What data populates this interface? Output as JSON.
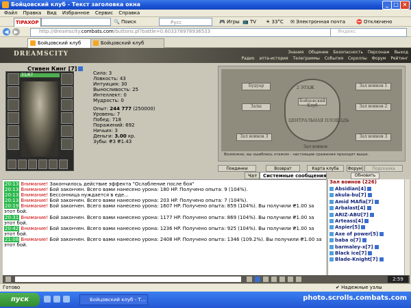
{
  "window": {
    "title": "Бойцовский клуб - Текст заголовка окна"
  },
  "menu": [
    "Файл",
    "Правка",
    "Вид",
    "Избранное",
    "Сервис",
    "Справка"
  ],
  "toolbar": {
    "brand": "TIPAXOP",
    "search_label": "Поиск",
    "search2_placeholder": "Русс",
    "games_label": "Игры",
    "tv_label": "TV",
    "weather": "33°C",
    "email": "Электронная почта",
    "disabled": "Отключено"
  },
  "address": {
    "url_prefix": "http://dreamscity.",
    "url_host": "combats.com",
    "url_path": "/buttons.pl?battle=0.603378978936533",
    "yandex_placeholder": "Яндекс"
  },
  "tabs": [
    {
      "label": "Бойцовский клуб",
      "active": true
    },
    {
      "label": "Бойцовский клуб",
      "active": false
    }
  ],
  "game_nav": {
    "logo": "DREAMSCITY",
    "row1": [
      "Знания",
      "Общение",
      "Безопасность",
      "Персонаж",
      "Выход"
    ],
    "row2": [
      "Радио",
      "эпта-история",
      "Телеграммы",
      "События",
      "Скроллы",
      "Форум",
      "Рейтинг"
    ]
  },
  "character": {
    "name": "Стивен Кинг",
    "level": "[7]",
    "hp": "31/67",
    "stats": [
      "Сила: 3",
      "Ловкость: 43",
      "Интуиция: 30",
      "Выносливость: 25",
      "Интеллект: 0",
      "Мудрость: 0"
    ],
    "stats2": [
      "Уровень: 7",
      "Побед: 718",
      "Поражений: 692",
      "Ничьих: 3"
    ],
    "exp_label": "Опыт:",
    "exp_value": "244 777",
    "exp_next": "(250000)",
    "money_label": "Деньги:",
    "money_value": "3.00",
    "money_unit": "кр.",
    "teeth": "Зубы: ₴3 ₴1.43"
  },
  "map": {
    "labels": [
      "Будуар",
      "2 ЭТАЖ",
      "Залы",
      "ЦЕНТРАЛЬНАЯ ПЛОЩАДЬ",
      "Зал воинов 1",
      "Зал воинов 2",
      "Зал воинов 3",
      "Зал воинов 3",
      "Бойцовский Клуб",
      "Зал воинов"
    ],
    "note": "Возможно, вы ошиблись этажом - настоящие сражения проходят выше."
  },
  "game_buttons": [
    "Поединки",
    "Возврат",
    "Карта клуба",
    "Форум",
    "Подсказка"
  ],
  "chat_tabs": [
    {
      "label": "Чат",
      "active": false
    },
    {
      "label": "Системные сообщения",
      "active": true
    }
  ],
  "messages": [
    {
      "time": "20:13",
      "prefix": "Внимание!",
      "text": "Закончилось действие эффекта \"Ослабление после боя\""
    },
    {
      "time": "20:13",
      "prefix": "Внимание!",
      "text": "Бой закончен. Всего вами нанесено урона: 180 HP. Получено опыта: 9 (104%)."
    },
    {
      "time": "20:13",
      "prefix": "Внимание!",
      "text": "Бессонница нуждается в еде..."
    },
    {
      "time": "20:13",
      "prefix": "Внимание!",
      "text": "Бой закончен. Всего вами нанесено урона: 203 HP. Получено опыта: 7 (104%)."
    },
    {
      "time": "20:19",
      "prefix": "Внимание!",
      "text": "Бой закончен. Всего вами нанесено урона: 1607 HP. Получено опыта: 859 (104%). Вы получили ₴1.00 за этот бой."
    },
    {
      "time": "20:31",
      "prefix": "Внимание!",
      "text": "Бой закончен. Всего вами нанесено урона: 1177 HP. Получено опыта: 869 (104%). Вы получили ₴1.00 за этот бой."
    },
    {
      "time": "20:42",
      "prefix": "Внимание!",
      "text": "Бой закончен. Всего вами нанесено урона: 1236 HP. Получено опыта: 925 (104%). Вы получили ₴1.00 за этот бой."
    },
    {
      "time": "21:08",
      "prefix": "Внимание!",
      "text": "Бой закончен. Всего вами нанесено урона: 2408 HP. Получено опыта: 1346 (109.2%). Вы получили ₴1.00 за этот бой."
    }
  ],
  "player_list": {
    "title": "Зал воинов (226)",
    "refresh": "Обновить",
    "players": [
      "Absidian[4]",
      "akula-bu[7]",
      "Amid MAfia[7]",
      "Arbalast[4]",
      "ARIZ-ABU[7]",
      "Arteass[4]",
      "Aspier[5]",
      "Axe of power[5]",
      "baba o[7]",
      "barmaley-x[7]",
      "Black ice[7]",
      "Blade-Knight[7]"
    ]
  },
  "clock": "2:59",
  "status": {
    "left": "Готово",
    "right": "Надежные узлы"
  },
  "taskbar": {
    "start": "пуск",
    "task": "Бойцовский клуб - Т...",
    "watermark": "photo.scrolls.combats.com"
  }
}
